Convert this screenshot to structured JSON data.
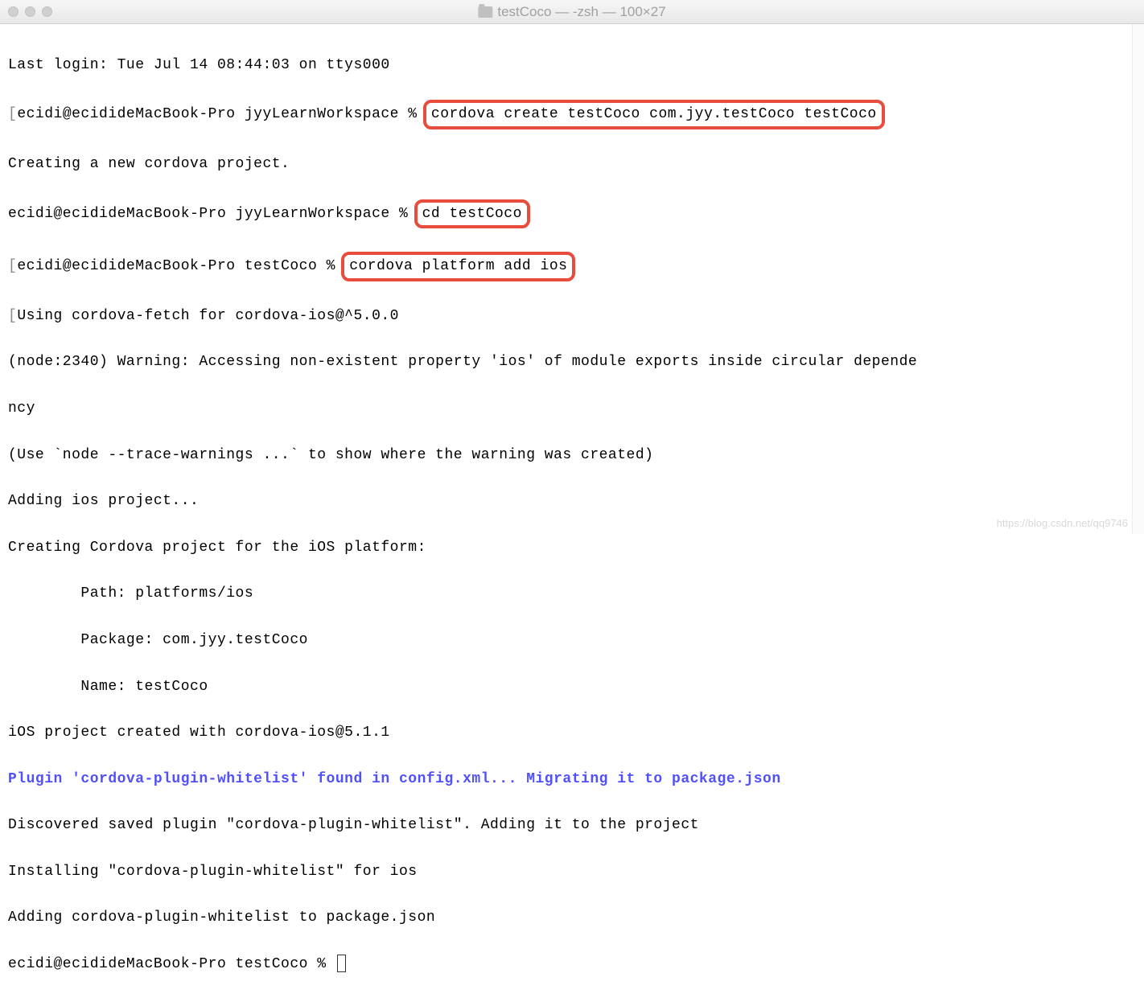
{
  "window": {
    "title": "testCoco — -zsh — 100×27"
  },
  "terminal": {
    "line1": "Last login: Tue Jul 14 08:44:03 on ttys000",
    "prompt1_prefix": "ecidi@ecidideMacBook-Pro jyyLearnWorkspace % ",
    "cmd1": "cordova create testCoco com.jyy.testCoco testCoco",
    "line3": "Creating a new cordova project.",
    "prompt2_prefix": "ecidi@ecidideMacBook-Pro jyyLearnWorkspace % ",
    "cmd2": "cd testCoco",
    "prompt3_prefix": "ecidi@ecidideMacBook-Pro testCoco % ",
    "cmd3": "cordova platform add ios",
    "line6": "Using cordova-fetch for cordova-ios@^5.0.0",
    "line7": "(node:2340) Warning: Accessing non-existent property 'ios' of module exports inside circular depende",
    "line8": "ncy",
    "line9": "(Use `node --trace-warnings ...` to show where the warning was created)",
    "line10": "Adding ios project...",
    "line11": "Creating Cordova project for the iOS platform:",
    "line12": "        Path: platforms/ios",
    "line13": "        Package: com.jyy.testCoco",
    "line14": "        Name: testCoco",
    "line15": "iOS project created with cordova-ios@5.1.1",
    "line16": "Plugin 'cordova-plugin-whitelist' found in config.xml... Migrating it to package.json",
    "line17": "Discovered saved plugin \"cordova-plugin-whitelist\". Adding it to the project",
    "line18": "Installing \"cordova-plugin-whitelist\" for ios",
    "line19": "Adding cordova-plugin-whitelist to package.json",
    "prompt4": "ecidi@ecidideMacBook-Pro testCoco % "
  },
  "watermark": "https://blog.csdn.net/qq9746"
}
